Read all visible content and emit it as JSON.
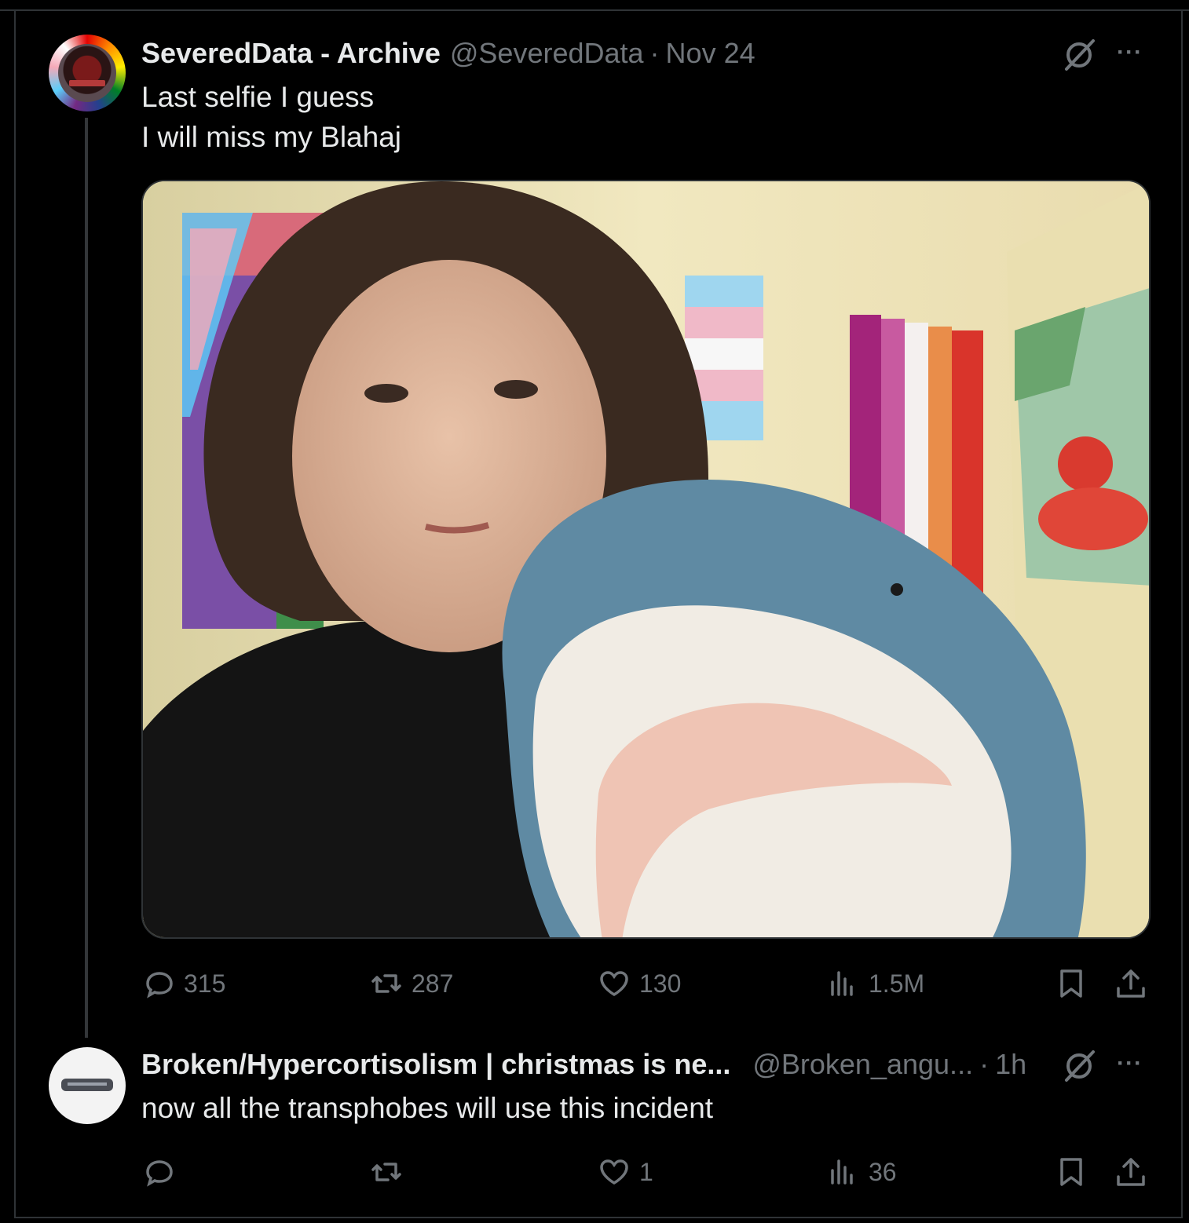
{
  "tweet": {
    "display_name": "SeveredData - Archive",
    "handle": "@SeveredData",
    "separator": "·",
    "time": "Nov 24",
    "text_line1": "Last selfie I guess",
    "text_line2": "I will miss my Blahaj",
    "more_label": "···",
    "actions": {
      "replies": "315",
      "reposts": "287",
      "likes": "130",
      "views": "1.5M"
    }
  },
  "reply": {
    "display_name": "Broken/Hypercortisolism | christmas is ne...",
    "handle": "@Broken_angu...",
    "separator": "·",
    "time": "1h",
    "text": "now all the transphobes will use this incident",
    "more_label": "···",
    "actions": {
      "replies": "",
      "reposts": "",
      "likes": "1",
      "views": "36"
    }
  },
  "icons": {
    "reply": "speech-bubble-icon",
    "repost": "repost-arrows-icon",
    "like": "heart-icon",
    "views": "bar-chart-icon",
    "bookmark": "bookmark-icon",
    "share": "share-upload-icon",
    "grok": "slashed-circle-icon",
    "more": "ellipsis-icon"
  },
  "colors": {
    "background": "#000000",
    "text": "#e7e9ea",
    "muted": "#71767b",
    "border": "#2f3336"
  }
}
